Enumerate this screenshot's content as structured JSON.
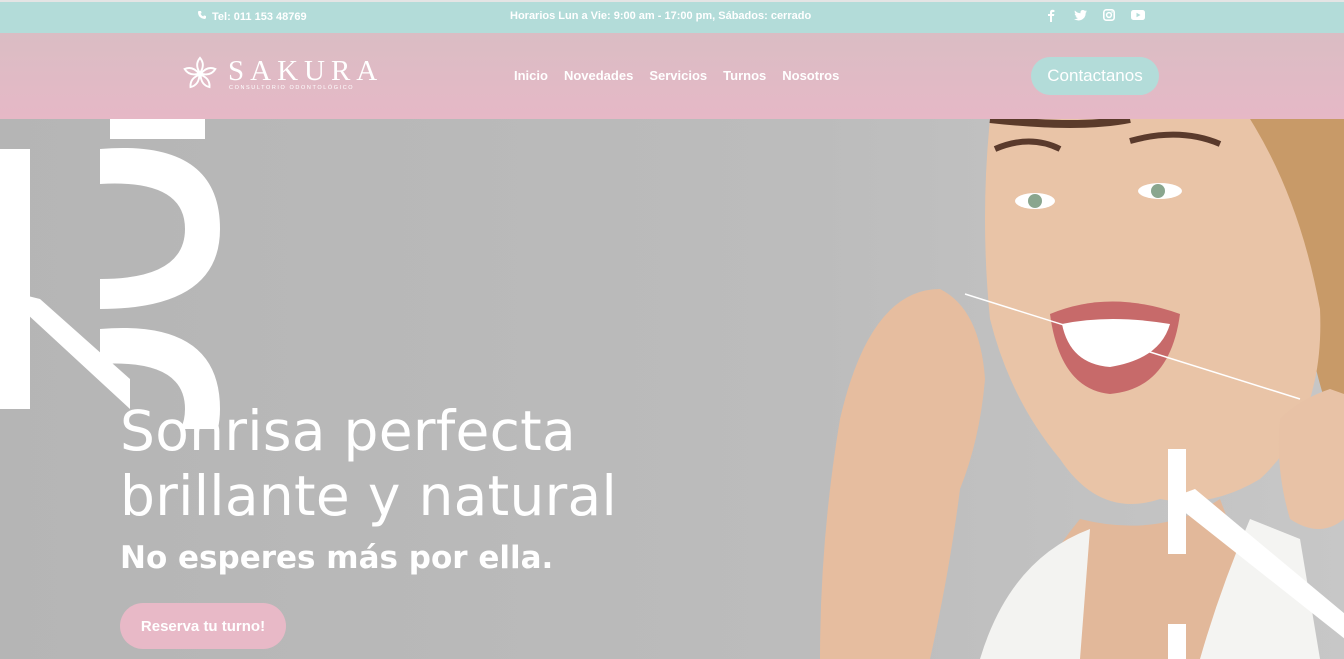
{
  "topbar": {
    "phone": "Tel: 011 153 48769",
    "hours": "Horarios Lun a Vie: 9:00 am - 17:00 pm, Sábados: cerrado",
    "social_icons": [
      "facebook-icon",
      "twitter-icon",
      "instagram-icon",
      "youtube-icon"
    ]
  },
  "header": {
    "brand": "SAKURA",
    "tagline": "CONSULTORIO ODONTOLÓGICO",
    "nav": [
      "Inicio",
      "Novedades",
      "Servicios",
      "Turnos",
      "Nosotros"
    ],
    "contact_label": "Contactanos"
  },
  "hero": {
    "headline_line1": "Sonrisa perfecta",
    "headline_line2": "brillante y natural",
    "subheadline": "No esperes más por ella.",
    "cta_label": "Reserva tu turno!"
  },
  "colors": {
    "topbar": "#b3dcd9",
    "header": "#e6b8c6",
    "accent_pink": "#e8b9c7",
    "hero_bg": "#b7b7b7"
  }
}
